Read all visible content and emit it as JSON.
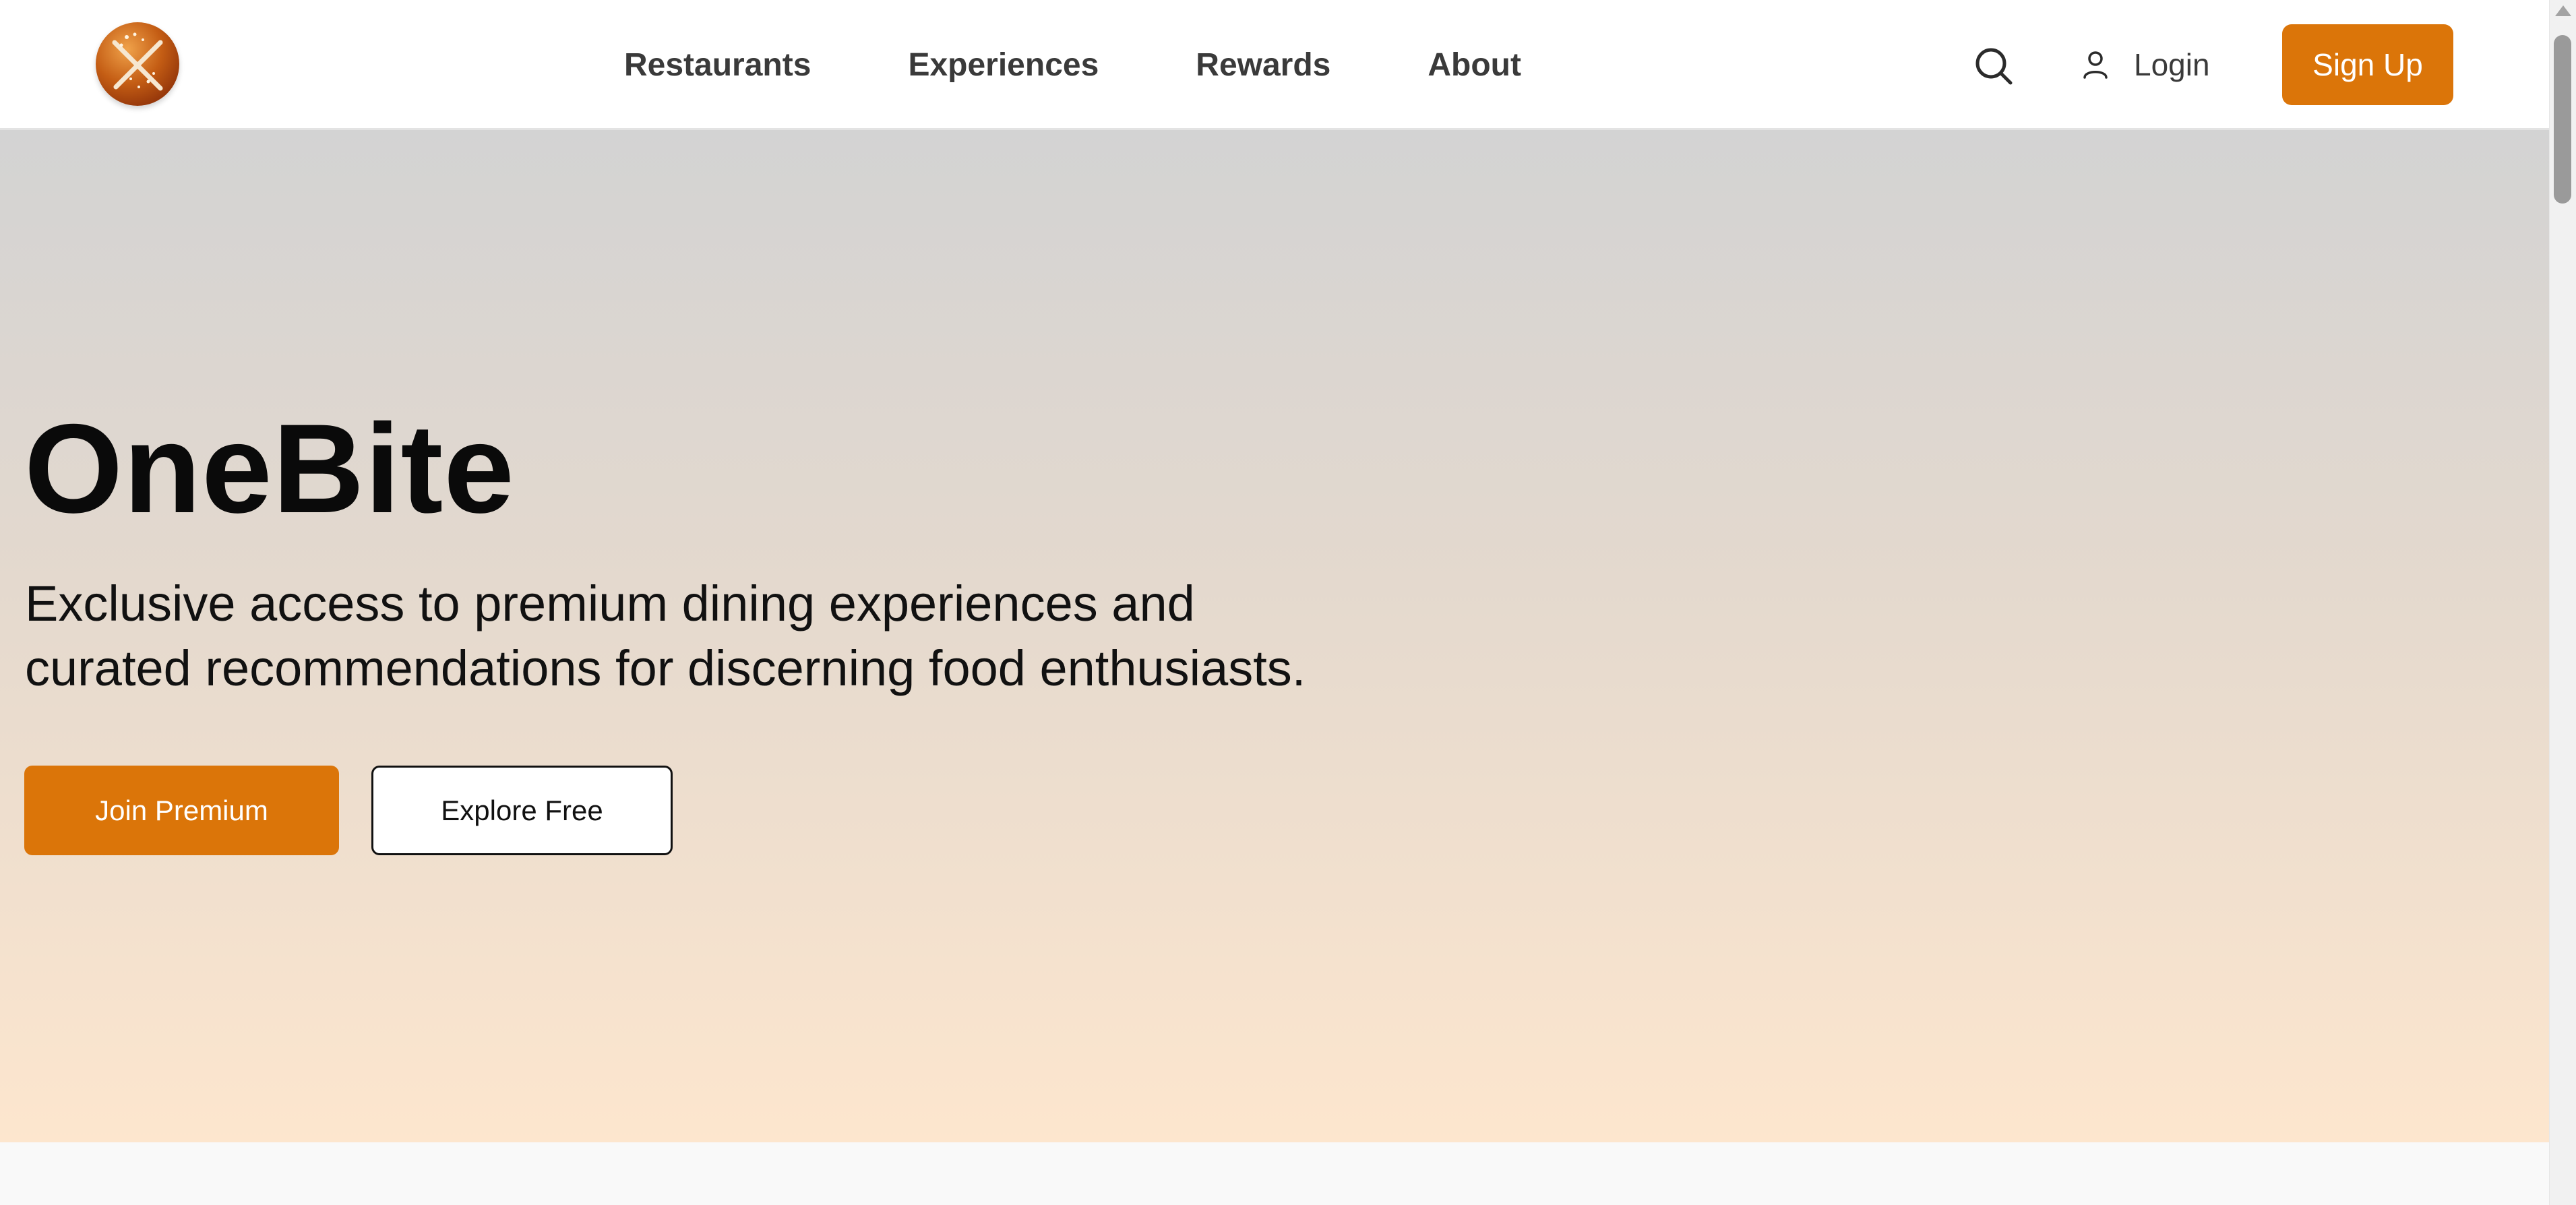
{
  "brand": {
    "logo_icon": "onebite-logo-icon"
  },
  "nav": {
    "items": [
      {
        "label": "Restaurants"
      },
      {
        "label": "Experiences"
      },
      {
        "label": "Rewards"
      },
      {
        "label": "About"
      }
    ]
  },
  "header_actions": {
    "search_icon": "search-icon",
    "user_icon": "user-icon",
    "login_label": "Login",
    "signup_label": "Sign Up"
  },
  "hero": {
    "title": "OneBite",
    "subtitle_line1": "Exclusive access to premium dining experiences and",
    "subtitle_line2": "curated recommendations for discerning food enthusiasts.",
    "primary_cta": "Join Premium",
    "secondary_cta": "Explore Free"
  },
  "colors": {
    "accent": "#db7509",
    "header_bg": "#ffffff",
    "hero_gradient_top": "#d3d3d3",
    "hero_gradient_bottom": "#fde6ce",
    "text_dark": "#0a0a0a",
    "nav_text": "#3a3a3a"
  }
}
